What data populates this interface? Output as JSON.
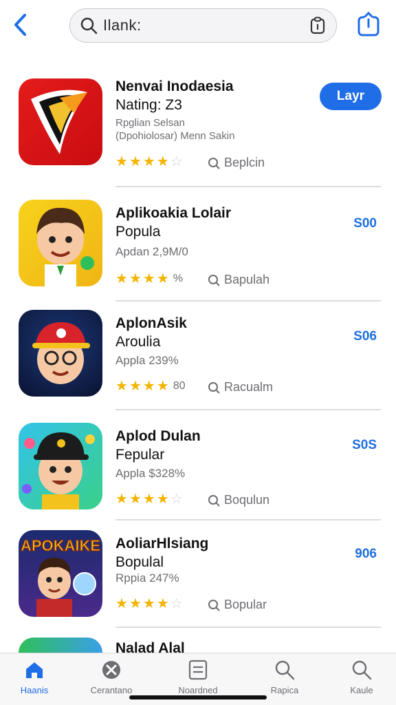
{
  "search": {
    "text": "Ilank:"
  },
  "apps": [
    {
      "title_line1": "Nenvai Inodaesia",
      "title_line2": "Nating: Z3",
      "subtitle": "Rpglian Selsan",
      "subtitle2": "(Dpohiolosar) Menn Sakin",
      "stars": 3.5,
      "rating_text": "",
      "tag": "Beplcin",
      "action": "Layr",
      "action_type": "button",
      "icon": "red-bird-icon"
    },
    {
      "title_line1": "Aplikoakia Lolair",
      "title_line2": "Popula",
      "subtitle": "Apdan 2,9M/0",
      "stars": 3.5,
      "rating_text": "%",
      "tag": "Bapulah",
      "action": "S00",
      "action_type": "price",
      "icon": "cartoon-boy-icon"
    },
    {
      "title_line1": "AplonAsik",
      "title_line2": "Aroulia",
      "subtitle": "Appla 239%",
      "stars": 3.5,
      "rating_text": "80",
      "tag": "Racualm",
      "action": "S06",
      "action_type": "price",
      "icon": "cap-boy-icon"
    },
    {
      "title_line1": "Aplod Dulan",
      "title_line2": "Fepular",
      "subtitle": "Appla $328%",
      "stars": 3.5,
      "rating_text": "",
      "tag": "Boqulun",
      "action": "S0S",
      "action_type": "price",
      "icon": "candy-boy-icon"
    },
    {
      "title_line1": "AoliarHlsiang",
      "title_line2": "Bopulal",
      "subtitle": "Rppia 247%",
      "stars": 3.5,
      "rating_text": "",
      "tag": "Bopular",
      "action": "906",
      "action_type": "price",
      "icon": "apokaike-icon",
      "icon_text": "APOKAIKE"
    },
    {
      "title_line1": "Nalad Alal",
      "icon": "partial-app-icon"
    }
  ],
  "tabs": [
    {
      "label": "Haanis",
      "icon": "home-icon",
      "active": true
    },
    {
      "label": "Cerantano",
      "icon": "tools-icon",
      "active": false
    },
    {
      "label": "Noardned",
      "icon": "list-icon",
      "active": false
    },
    {
      "label": "Rapica",
      "icon": "search-icon",
      "active": false
    },
    {
      "label": "Kaule",
      "icon": "search-icon",
      "active": false
    }
  ],
  "colors": {
    "accent": "#1f6ee8",
    "star": "#f5b400"
  }
}
